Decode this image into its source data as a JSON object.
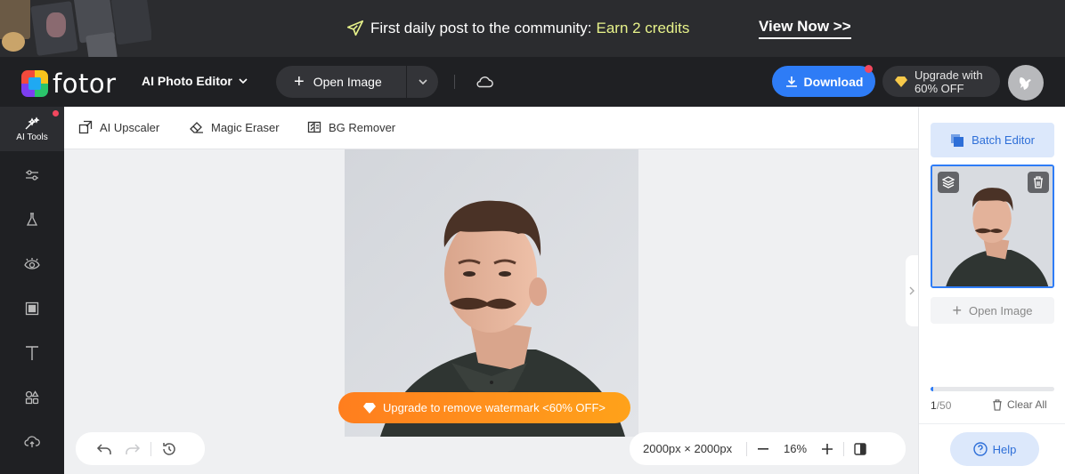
{
  "banner": {
    "message": "First daily post to the community:",
    "highlight": "Earn 2 credits",
    "cta": "View Now >>"
  },
  "header": {
    "logo_text": "fotor",
    "editor_mode": "AI Photo Editor",
    "open_image": "Open Image",
    "download": "Download",
    "upgrade_line1": "Upgrade with",
    "upgrade_line2": "60% OFF"
  },
  "sidebar": {
    "items": [
      {
        "label": "AI Tools",
        "icon": "ai-tools-icon"
      },
      {
        "label": "",
        "icon": "adjust-sliders-icon"
      },
      {
        "label": "",
        "icon": "beauty-flask-icon"
      },
      {
        "label": "",
        "icon": "eye-icon"
      },
      {
        "label": "",
        "icon": "frame-icon"
      },
      {
        "label": "",
        "icon": "text-icon"
      },
      {
        "label": "",
        "icon": "elements-icon"
      },
      {
        "label": "",
        "icon": "cloud-upload-icon"
      }
    ]
  },
  "toolbar": {
    "tools": [
      "AI Upscaler",
      "Magic Eraser",
      "BG Remover"
    ]
  },
  "canvas": {
    "watermark_cta": "Upgrade to remove watermark <60% OFF>",
    "dimensions": "2000px × 2000px",
    "zoom": "16%"
  },
  "rightpanel": {
    "batch_editor": "Batch Editor",
    "open_image": "Open Image",
    "count_current": "1",
    "count_total": "/50",
    "progress_fraction": 0.02,
    "clear_all": "Clear All",
    "help": "Help"
  },
  "colors": {
    "accent": "#2e7cf6",
    "highlight": "#e7f28a",
    "watermark": "#ff8c1e"
  }
}
